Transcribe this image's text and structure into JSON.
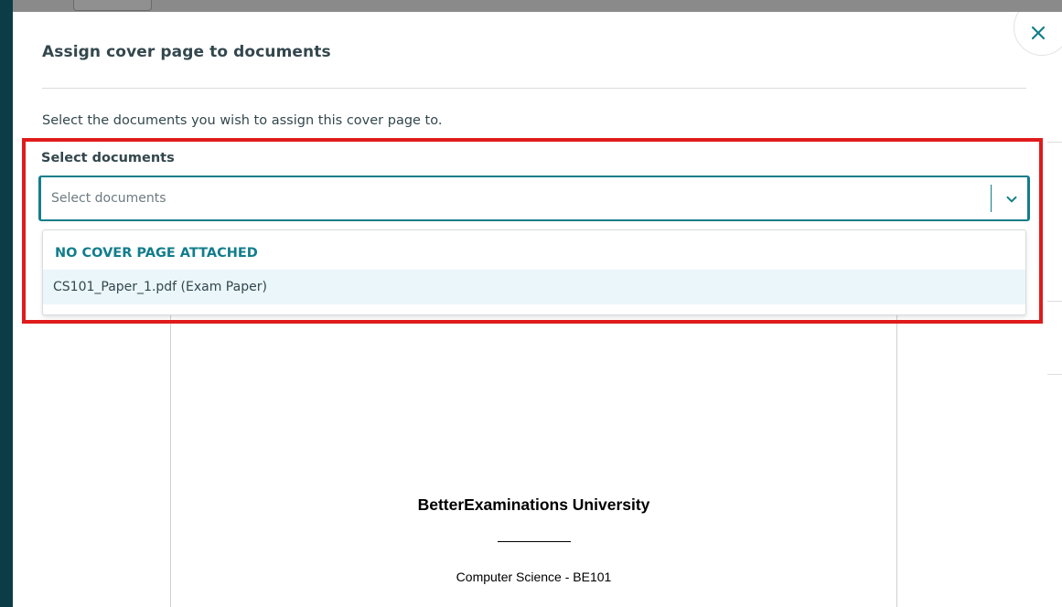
{
  "modal": {
    "title": "Assign cover page to documents",
    "instructions": "Select the documents you wish to assign this cover page to.",
    "close_icon": "close-icon"
  },
  "select": {
    "label": "Select documents",
    "placeholder": "Select documents",
    "chevron_icon": "chevron-down-icon",
    "accent_color": "#127e8a"
  },
  "dropdown": {
    "group_header": "NO COVER PAGE ATTACHED",
    "options": [
      {
        "label": "CS101_Paper_1.pdf (Exam Paper)"
      }
    ]
  },
  "preview": {
    "university": "BetterExaminations University",
    "course": "Computer Science - BE101"
  },
  "highlight_color": "#e01b1b"
}
